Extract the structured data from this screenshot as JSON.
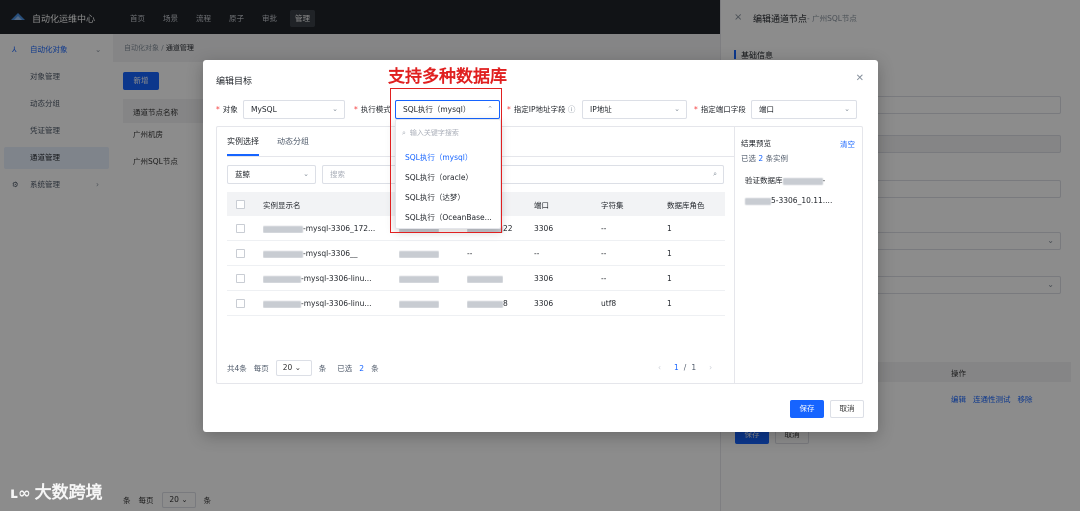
{
  "app": {
    "title": "自动化运维中心"
  },
  "topnav": [
    {
      "label": "首页",
      "active": false
    },
    {
      "label": "场景",
      "active": false
    },
    {
      "label": "流程",
      "active": false
    },
    {
      "label": "原子",
      "active": false
    },
    {
      "label": "审批",
      "active": false
    },
    {
      "label": "管理",
      "active": true
    }
  ],
  "sidebar": {
    "group": "自动化对象",
    "items": [
      "对象管理",
      "动态分组",
      "凭证管理",
      "通道管理"
    ],
    "active_item": "通道管理",
    "bottom_group": "系统管理"
  },
  "breadcrumb": {
    "parent": "自动化对象",
    "separator": "/",
    "current": "通道管理"
  },
  "bg_page": {
    "new_button": "新增",
    "column_header": "通道节点名称",
    "rows": [
      "广州机房",
      "广州SQL节点"
    ],
    "pager": {
      "per_page_label": "每页",
      "per_page_value": "20",
      "unit": "条",
      "total_prefix": "条"
    }
  },
  "drawer": {
    "title": "编辑通道节点",
    "subtitle": "- 广州SQL节点",
    "section": "基础信息",
    "ops_header": "操作",
    "ops_links": [
      "编辑",
      "连通性测试",
      "移除"
    ],
    "save_label": "保存",
    "cancel_label": "取消"
  },
  "modal": {
    "title": "编辑目标",
    "fields": {
      "object_label": "对象",
      "object_value": "MySQL",
      "exec_label": "执行模式",
      "exec_value": "SQL执行（mysql）",
      "ip_label": "指定IP地址字段",
      "ip_value": "IP地址",
      "port_label": "指定端口字段",
      "port_value": "端口"
    },
    "tabs": [
      "实例选择",
      "动态分组"
    ],
    "active_tab": "实例选择",
    "filter_value": "蓝鲸",
    "search_placeholder": "搜索",
    "columns": [
      "实例显示名",
      "端口",
      "字符集",
      "数据库角色"
    ],
    "rows": [
      {
        "name_suffix": "-mysql-3306_172...",
        "ip_tail": "22",
        "port": "3306",
        "charset": "--",
        "role": "1"
      },
      {
        "name_suffix": "-mysql-3306__",
        "ip_tail": "--",
        "port": "--",
        "charset": "--",
        "role": "1"
      },
      {
        "name_suffix": "-mysql-3306-linu...",
        "ip_tail": "",
        "port": "3306",
        "charset": "--",
        "role": "1"
      },
      {
        "name_suffix": "-mysql-3306-linu...",
        "ip_tail": "8",
        "port": "3306",
        "charset": "utf8",
        "role": "1"
      }
    ],
    "footer": {
      "total": "共4条",
      "per_page_label": "每页",
      "per_page_value": "20",
      "unit": "条",
      "selected_prefix": "已选",
      "selected_count": "2",
      "selected_unit": "条",
      "page_current": "1",
      "page_sep": "/",
      "page_total": "1"
    },
    "result": {
      "title": "结果预览",
      "clear": "清空",
      "selected_prefix": "已选",
      "selected_count": "2",
      "selected_suffix": "条实例",
      "item1_prefix": "验证数据库",
      "item2_suffix": "5-3306_10.11...."
    },
    "save_label": "保存",
    "cancel_label": "取消"
  },
  "dropdown": {
    "search_placeholder": "输入关键字搜索",
    "options": [
      "SQL执行（mysql）",
      "SQL执行（oracle）",
      "SQL执行（达梦）",
      "SQL执行（OceanBase..."
    ],
    "selected": "SQL执行（mysql）"
  },
  "annotation": {
    "text": "支持多种数据库",
    "color": "#e02020"
  },
  "watermark": {
    "text": "大数跨境"
  },
  "colors": {
    "accent": "#1664ff",
    "topbar": "#1f2329",
    "annotation": "#e02020"
  }
}
